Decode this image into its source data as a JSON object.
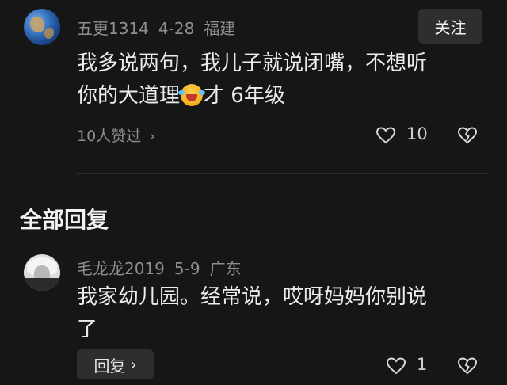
{
  "comment": {
    "username": "五更1314",
    "date": "4-28",
    "location": "福建",
    "follow_label": "关注",
    "text_line1": "我多说两句，我儿子就说闭嘴，不想听",
    "text_line2_prefix": "你的大道理",
    "emoji": "laughing-crying-emoji",
    "text_line2_suffix": "才 6年级",
    "likes_summary": "10人赞过",
    "like_count": "10"
  },
  "section_title": "全部回复",
  "reply": {
    "username": "毛龙龙2019",
    "date": "5-9",
    "location": "广东",
    "text_line1": "我家幼儿园。经常说，哎呀妈妈你别说",
    "text_line2": "了",
    "reply_label": "回复",
    "like_count": "1"
  },
  "chevron": "›"
}
